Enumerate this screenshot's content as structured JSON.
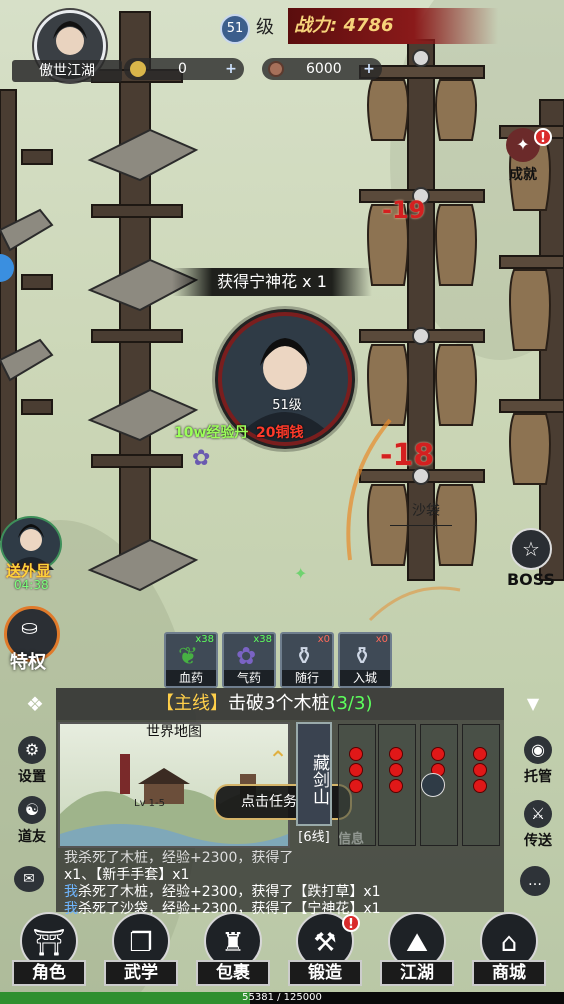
{
  "player": {
    "name": "傲世江湖",
    "level": "51",
    "level_suffix": "级",
    "power": "战力: 4786"
  },
  "resources": {
    "currency_a": "0",
    "currency_b": "6000"
  },
  "toast": "获得宁神花 x 1",
  "hero": {
    "level_label": "51级"
  },
  "floating": {
    "exp_reward": "10w经验丹",
    "money_reward": "20铜钱",
    "damage_1": "-19",
    "damage_2": "-18",
    "target_name": "沙袋"
  },
  "right_top": {
    "achievement": "成就",
    "boss": "BOSS"
  },
  "left_side": {
    "escort": "送外显",
    "escort_timer": "04:38",
    "privilege": "特权"
  },
  "items": [
    {
      "label": "血药",
      "count": "x38"
    },
    {
      "label": "气药",
      "count": "x38"
    },
    {
      "label": "随行",
      "count": "x0"
    },
    {
      "label": "入城",
      "count": "x0"
    }
  ],
  "quest": {
    "tag": "【主线】",
    "text": "击破3个木桩",
    "progress": "(3/3)"
  },
  "map": {
    "title": "世界地图",
    "level_range": "Lv 1-5",
    "tip": "点击任务面板"
  },
  "line_panel": {
    "name": "藏剑山",
    "line": "[6线]",
    "info": "信息"
  },
  "left_buttons": {
    "settings": "设置",
    "friends": "道友"
  },
  "right_buttons": {
    "auto": "托管",
    "teleport": "传送"
  },
  "log": {
    "line1_prefix": "我杀死了木桩，经验+2300，获得了",
    "line2": "x1、【新手手套】x1",
    "line3_a": "我",
    "line3_b": "杀死了木桩，经验+2300，获得了【跌打草】x1",
    "line4_a": "我",
    "line4_b": "杀死了沙袋，经验+2300，获得了【宁神花】x1"
  },
  "nav": [
    "角色",
    "武学",
    "包裹",
    "锻造",
    "江湖",
    "商城"
  ],
  "exp": {
    "text": "55381 / 125000",
    "current": 55381,
    "max": 125000
  },
  "colors": {
    "accent_red": "#d42020",
    "exp_green": "#2f8f2f",
    "quest_green": "#5dff5d"
  }
}
